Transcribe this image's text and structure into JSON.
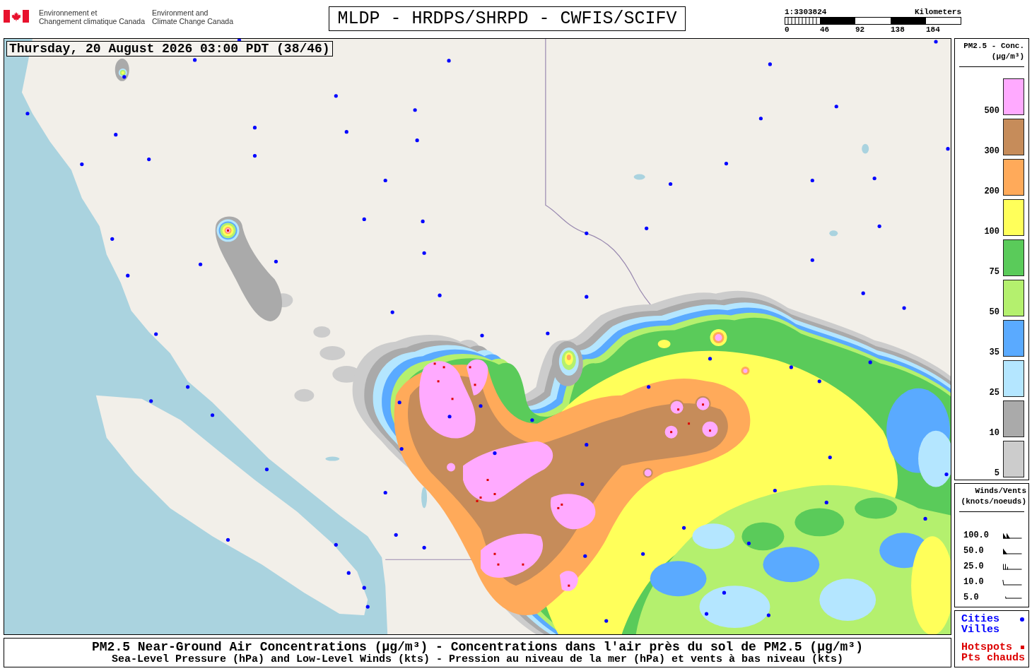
{
  "header": {
    "agency_fr": "Environnement et\nChangement climatique Canada",
    "agency_en": "Environment and\nClimate Change Canada",
    "title": "MLDP - HRDPS/SHRPD - CWFIS/SCIFV",
    "scale": {
      "ratio": "1:3303824",
      "unit": "Kilometers",
      "ticks": [
        "0",
        "46",
        "92",
        "138",
        "184"
      ]
    }
  },
  "map": {
    "timestamp": "Thursday, 20 August 2026 03:00 PDT (38/46)"
  },
  "concentration_legend": {
    "title": "PM2.5 - Conc.",
    "unit": "(µg/m³)",
    "items": [
      {
        "label": "500",
        "color": "#ffaaff"
      },
      {
        "label": "300",
        "color": "#c68c5a"
      },
      {
        "label": "200",
        "color": "#ffaa5a"
      },
      {
        "label": "100",
        "color": "#ffff5a"
      },
      {
        "label": "75",
        "color": "#5acb5a"
      },
      {
        "label": "50",
        "color": "#b4f06e"
      },
      {
        "label": "35",
        "color": "#5aaaff"
      },
      {
        "label": "25",
        "color": "#b4e6ff"
      },
      {
        "label": "10",
        "color": "#aaaaaa"
      },
      {
        "label": "5",
        "color": "#cccccc"
      }
    ]
  },
  "wind_legend": {
    "title": "Winds/Vents",
    "unit": "(knots/noeuds)",
    "items": [
      "100.0",
      "50.0",
      "25.0",
      "10.0",
      "5.0"
    ]
  },
  "marker_legend": {
    "items": [
      {
        "kind": "dot",
        "color": "#0000ff",
        "labels": [
          "Cities",
          "Villes"
        ]
      },
      {
        "kind": "square",
        "color": "#dd0000",
        "labels": [
          "Hotspots",
          "Pts chauds"
        ]
      }
    ]
  },
  "caption": {
    "title": "PM2.5 Near-Ground Air Concentrations (µg/m³) - Concentrations dans l'air près du sol de PM2.5 (µg/m³)",
    "subtitle": "Sea-Level Pressure (hPa) and Low-Level Winds (kts) - Pression au niveau de la mer (hPa) et vents à bas niveau (kts)"
  }
}
